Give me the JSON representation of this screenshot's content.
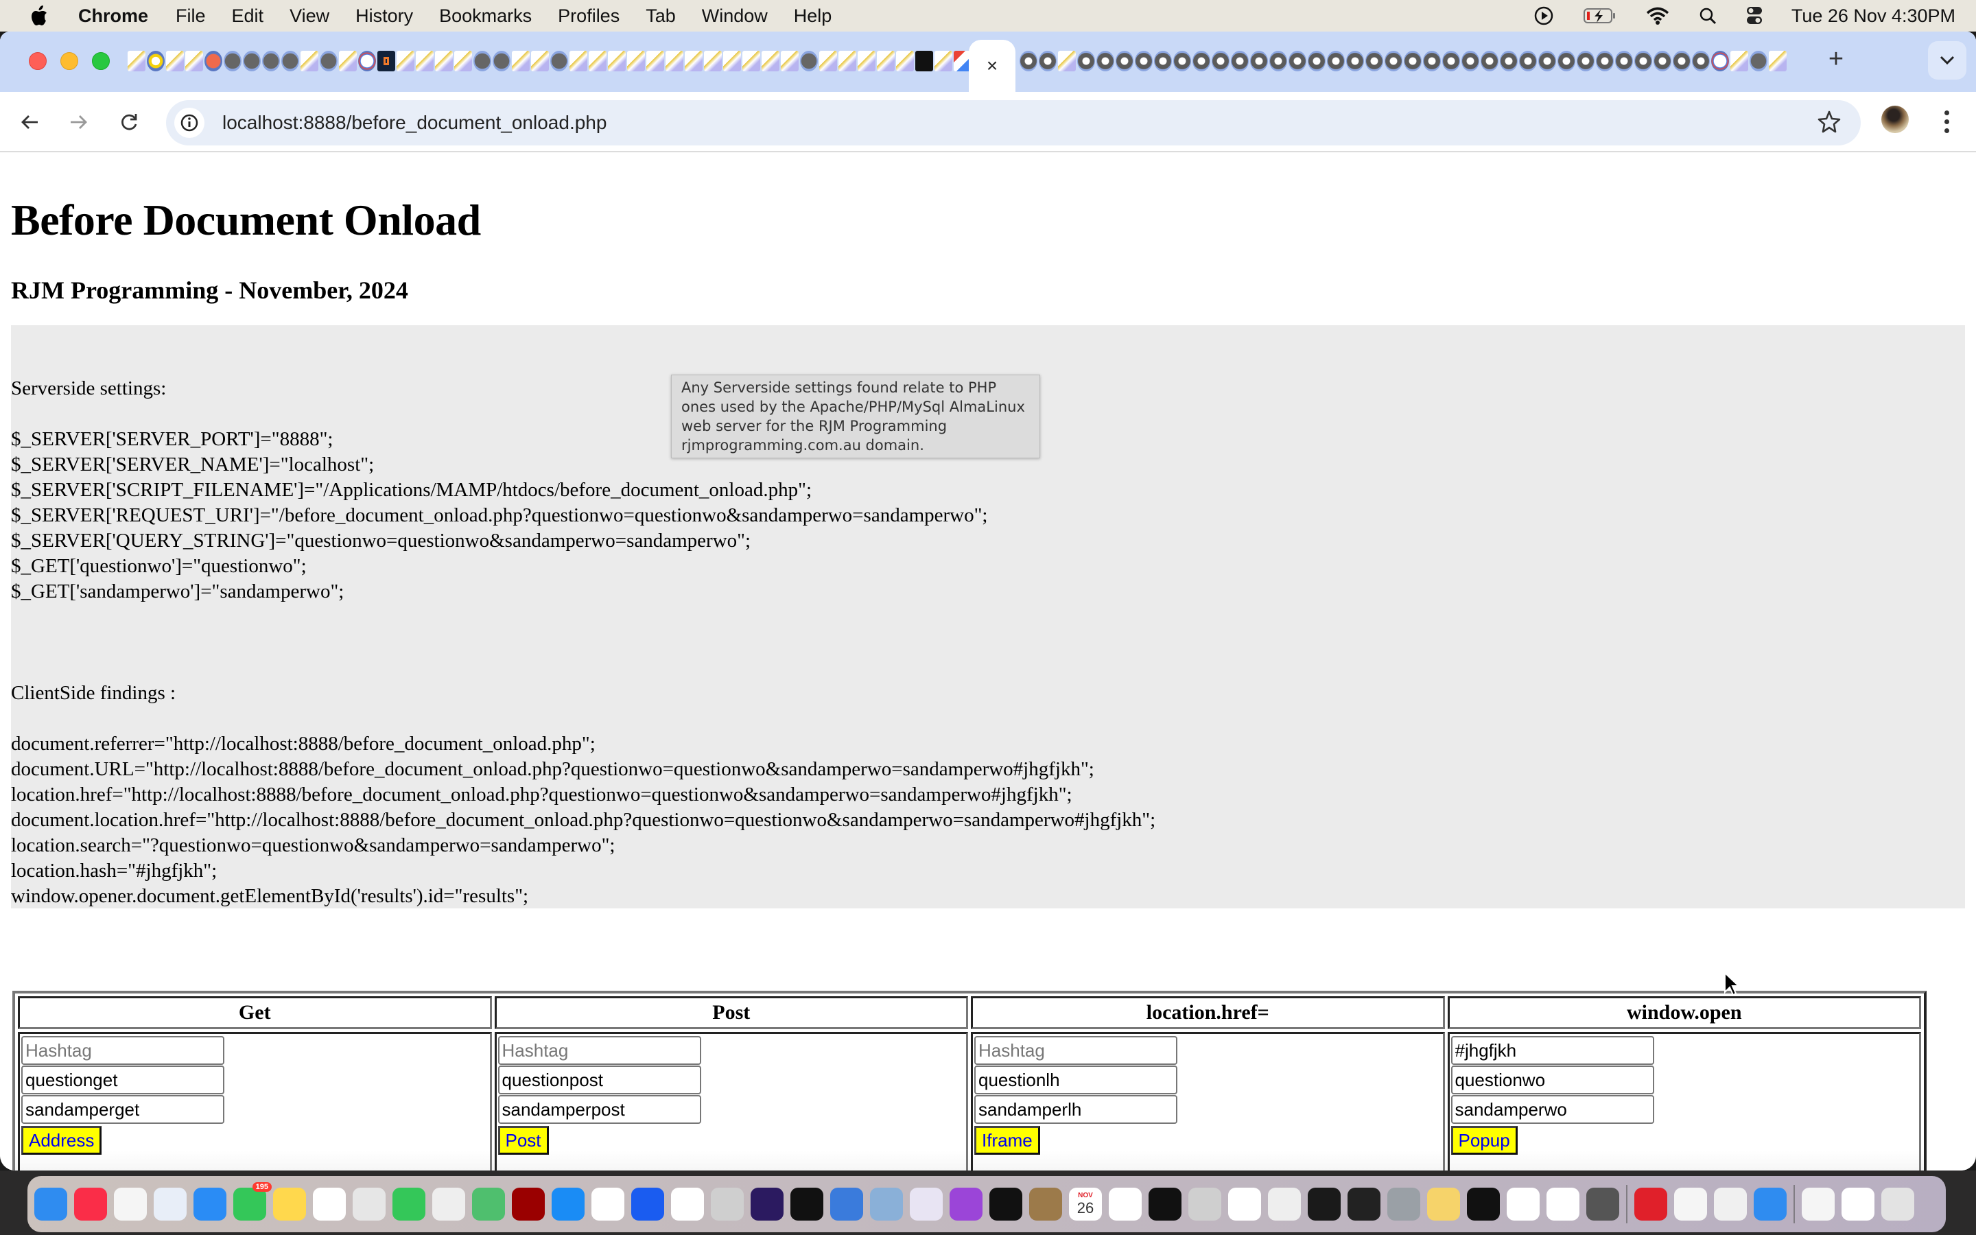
{
  "menubar": {
    "app_name": "Chrome",
    "items": [
      "File",
      "Edit",
      "View",
      "History",
      "Bookmarks",
      "Profiles",
      "Tab",
      "Window",
      "Help"
    ],
    "clock": "Tue 26 Nov  4:30PM",
    "status_icons": [
      "play-icon",
      "battery-charging-icon",
      "wifi-icon",
      "spotlight-search-icon",
      "control-center-icon"
    ]
  },
  "browser": {
    "active_tab_close": "×",
    "new_tab_label": "+",
    "url": "localhost:8888/before_document_onload.php"
  },
  "page": {
    "title": "Before Document Onload",
    "subtitle": "RJM Programming - November, 2024",
    "serverside_label": "Serverside settings:",
    "serverside_lines": [
      "$_SERVER['SERVER_PORT']=\"8888\";",
      "$_SERVER['SERVER_NAME']=\"localhost\";",
      "$_SERVER['SCRIPT_FILENAME']=\"/Applications/MAMP/htdocs/before_document_onload.php\";",
      "$_SERVER['REQUEST_URI']=\"/before_document_onload.php?questionwo=questionwo&sandamperwo=sandamperwo\";",
      "$_SERVER['QUERY_STRING']=\"questionwo=questionwo&sandamperwo=sandamperwo\";",
      "$_GET['questionwo']=\"questionwo\";",
      "$_GET['sandamperwo']=\"sandamperwo\";"
    ],
    "tooltip": "Any Serverside settings found relate to PHP ones used by the Apache/PHP/MySql AlmaLinux web server for the RJM Programming rjmprogramming.com.au domain.",
    "clientside_label": "ClientSide findings :",
    "clientside_lines": [
      "document.referrer=\"http://localhost:8888/before_document_onload.php\";",
      "document.URL=\"http://localhost:8888/before_document_onload.php?questionwo=questionwo&sandamperwo=sandamperwo#jhgfjkh\";",
      "location.href=\"http://localhost:8888/before_document_onload.php?questionwo=questionwo&sandamperwo=sandamperwo#jhgfjkh\";",
      "document.location.href=\"http://localhost:8888/before_document_onload.php?questionwo=questionwo&sandamperwo=sandamperwo#jhgfjkh\";",
      "location.search=\"?questionwo=questionwo&sandamperwo=sandamperwo\";",
      "location.hash=\"#jhgfjkh\";",
      "window.opener.document.getElementById('results').id=\"results\";"
    ],
    "forms": [
      {
        "header": "Get",
        "hashtag_placeholder": "Hashtag",
        "hashtag_value": "",
        "question_value": "questionget",
        "sandamper_value": "sandamperget",
        "button_label": "Address"
      },
      {
        "header": "Post",
        "hashtag_placeholder": "Hashtag",
        "hashtag_value": "",
        "question_value": "questionpost",
        "sandamper_value": "sandamperpost",
        "button_label": "Post"
      },
      {
        "header": "location.href=",
        "hashtag_placeholder": "Hashtag",
        "hashtag_value": "",
        "question_value": "questionlh",
        "sandamper_value": "sandamperlh",
        "button_label": "Iframe"
      },
      {
        "header": "window.open",
        "hashtag_placeholder": "Hashtag",
        "hashtag_value": "#jhgfjkh",
        "question_value": "questionwo",
        "sandamper_value": "sandamperwo",
        "button_label": "Popup"
      }
    ]
  },
  "dock": {
    "messages_badge": "195",
    "calendar_month": "NOV",
    "calendar_day": "26",
    "apps": [
      "Finder",
      "Music",
      "Reminders",
      "Safari",
      "Mail",
      "Messages",
      "Notes",
      "Freeform",
      "Launchpad",
      "FaceTime",
      "TextEdit",
      "Maps",
      "FileZilla",
      "App Store",
      "News",
      "Zoom",
      "Photos",
      "GIMP",
      "Firefox",
      "Apple TV",
      "Xcode",
      "Preview",
      "BBEdit",
      "Podcasts",
      "Terminal exec",
      "Contacts",
      "Calendar",
      "Opera",
      "Terminal",
      "Calculator",
      "Chrome",
      "LibreOffice",
      "QuickTime",
      "IntelliJ IDEA",
      "System Settings",
      "Paintbrush",
      "Terminal exec 2",
      "CMake",
      "Inkscape",
      "MAMP",
      "Photo Booth",
      "X11",
      "Script Editor",
      "Safari Technology Preview",
      "Document",
      "Chrome minimized",
      "Trash"
    ]
  },
  "colors": {
    "button_bg": "#ffff00",
    "button_text": "#0000ee",
    "panel_bg": "#ebebeb",
    "tabstrip_bg": "#c9d9f7"
  }
}
